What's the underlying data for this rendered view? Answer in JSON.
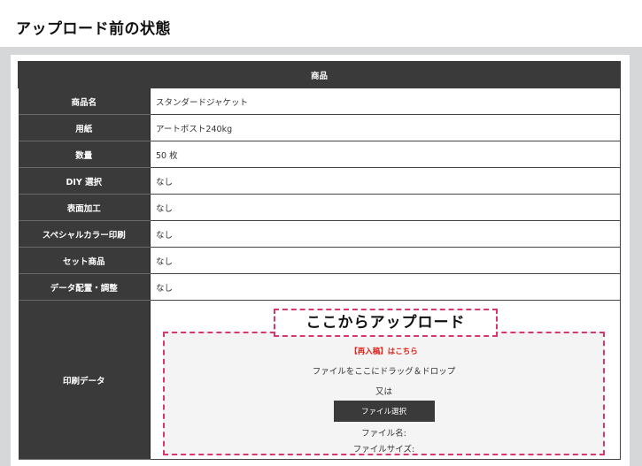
{
  "page": {
    "heading": "アップロード前の状態"
  },
  "table": {
    "header": "商品",
    "rows": [
      {
        "label": "商品名",
        "value": "スタンダードジャケット"
      },
      {
        "label": "用紙",
        "value": "アートポスト240kg"
      },
      {
        "label": "数量",
        "value": "50 枚"
      },
      {
        "label": "DIY 選択",
        "value": "なし"
      },
      {
        "label": "表面加工",
        "value": "なし"
      },
      {
        "label": "スペシャルカラー印刷",
        "value": "なし"
      },
      {
        "label": "セット商品",
        "value": "なし"
      },
      {
        "label": "データ配置・調整",
        "value": "なし"
      }
    ],
    "print_data_label": "印刷データ"
  },
  "upload": {
    "title": "ここからアップロード",
    "re_entry_link": "【再入稿】はこちら",
    "drop_text": "ファイルをここにドラッグ＆ドロップ",
    "or_text": "又は",
    "select_button": "ファイル選択",
    "file_name_label": "ファイル名:",
    "file_size_label": "ファイルサイズ:"
  },
  "colors": {
    "dark": "#3a3a3a",
    "accent": "#d8366f",
    "link_red": "#e0211b",
    "frame_gray": "#d6d7d9"
  }
}
